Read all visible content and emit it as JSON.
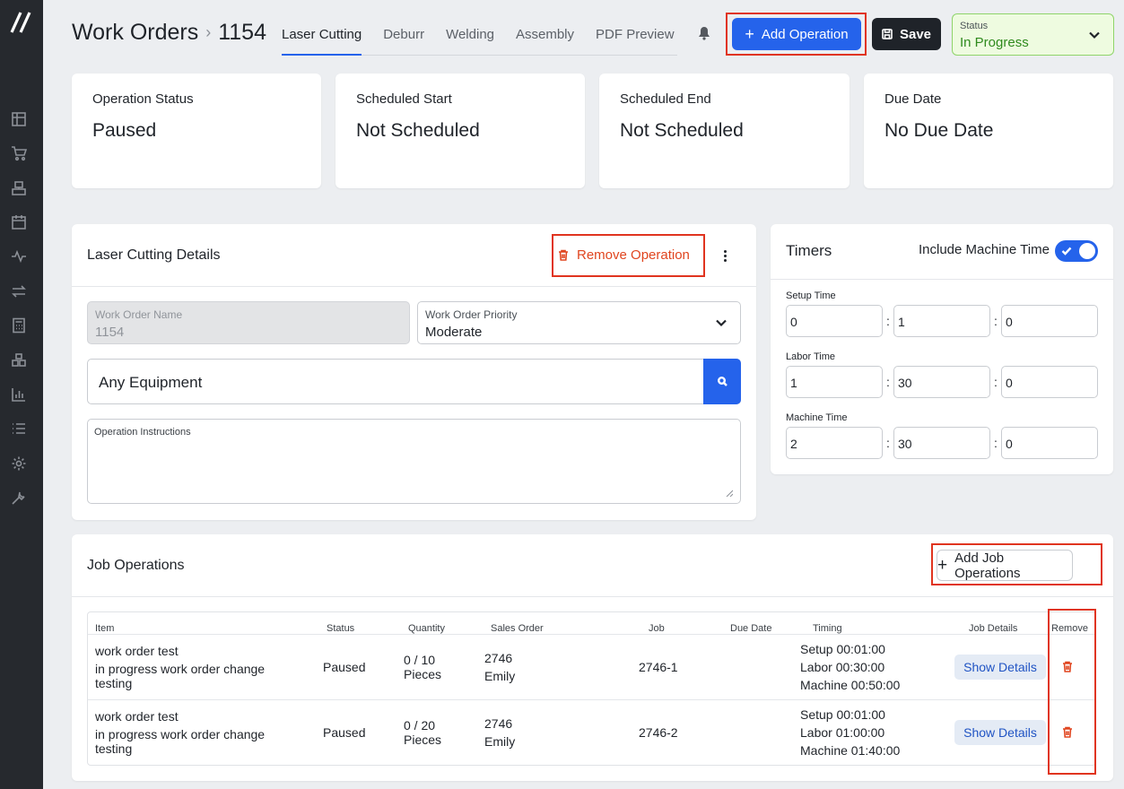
{
  "header": {
    "title": "Work Orders",
    "separator": "›",
    "id": "1154",
    "tabs": [
      "Laser Cutting",
      "Deburr",
      "Welding",
      "Assembly",
      "PDF Preview"
    ],
    "active_tab": "Laser Cutting",
    "add_operation_label": "Add Operation",
    "save_label": "Save",
    "status_label": "Status",
    "status_value": "In Progress"
  },
  "sidebar": {
    "icons": [
      "dashboard-icon",
      "cart-icon",
      "production-icon",
      "calendar-icon",
      "activity-icon",
      "transfer-icon",
      "calculator-icon",
      "inventory-icon",
      "reports-icon",
      "list-icon",
      "settings-icon",
      "tools-icon"
    ]
  },
  "stats": [
    {
      "label": "Operation Status",
      "value": "Paused"
    },
    {
      "label": "Scheduled Start",
      "value": "Not Scheduled"
    },
    {
      "label": "Scheduled End",
      "value": "Not Scheduled"
    },
    {
      "label": "Due Date",
      "value": "No Due Date"
    }
  ],
  "details": {
    "title": "Laser Cutting Details",
    "remove_label": "Remove Operation",
    "work_order_name_label": "Work Order Name",
    "work_order_name_value": "1154",
    "priority_label": "Work Order Priority",
    "priority_value": "Moderate",
    "equipment_value": "Any Equipment",
    "instructions_label": "Operation Instructions"
  },
  "timers": {
    "title": "Timers",
    "toggle_label": "Include Machine Time",
    "toggle_on": true,
    "separator": ":",
    "rows": [
      {
        "label": "Setup Time",
        "h": "0",
        "m": "1",
        "s": "0"
      },
      {
        "label": "Labor Time",
        "h": "1",
        "m": "30",
        "s": "0"
      },
      {
        "label": "Machine Time",
        "h": "2",
        "m": "30",
        "s": "0"
      }
    ]
  },
  "jobs": {
    "title": "Job Operations",
    "add_label": "Add Job Operations",
    "columns": [
      "Item",
      "Status",
      "Quantity",
      "Sales Order",
      "Job",
      "Due Date",
      "Timing",
      "Job Details",
      "Remove"
    ],
    "show_details_label": "Show Details",
    "rows": [
      {
        "item": "work order test",
        "item_sub": "in progress work order change testing",
        "status": "Paused",
        "qty": "0 / 10",
        "qty_unit": "Pieces",
        "so": "2746",
        "so_name": "Emily",
        "job": "2746-1",
        "due": "",
        "setup": "Setup 00:01:00",
        "labor": "Labor 00:30:00",
        "machine": "Machine 00:50:00"
      },
      {
        "item": "work order test",
        "item_sub": "in progress work order change testing",
        "status": "Paused",
        "qty": "0 / 20",
        "qty_unit": "Pieces",
        "so": "2746",
        "so_name": "Emily",
        "job": "2746-2",
        "due": "",
        "setup": "Setup 00:01:00",
        "labor": "Labor 01:00:00",
        "machine": "Machine 01:40:00"
      }
    ]
  },
  "colors": {
    "accent": "#2563eb",
    "highlight": "#e0341f",
    "danger": "#e0451f",
    "status_bg": "#eefbe0",
    "status_text": "#2f8a1d",
    "sidebar": "#26292e"
  }
}
